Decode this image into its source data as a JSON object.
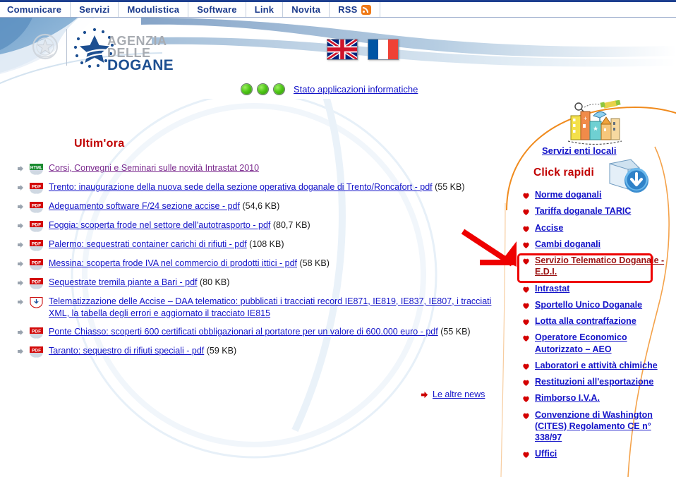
{
  "topnav": {
    "items": [
      {
        "label": "Comunicare",
        "icon": ""
      },
      {
        "label": "Servizi",
        "icon": ""
      },
      {
        "label": "Modulistica",
        "icon": ""
      },
      {
        "label": "Software",
        "icon": ""
      },
      {
        "label": "Link",
        "icon": ""
      },
      {
        "label": "Novita",
        "icon": ""
      },
      {
        "label": "RSS",
        "icon": "rss-icon"
      }
    ]
  },
  "header": {
    "emblem_icon": "italian-republic-emblem",
    "logo_star_icon": "agenzia-dogane-star-logo",
    "logo_line1": "AGENZIA",
    "logo_line2": "DELLE",
    "logo_line3": "DOGANE",
    "flags": [
      {
        "name": "flag-uk",
        "label": "English"
      },
      {
        "name": "flag-fr",
        "label": "Français"
      }
    ]
  },
  "status_line": {
    "dots": 3,
    "dot_color": "#4fc717",
    "link_label": "Stato applicazioni informatiche"
  },
  "content": {
    "heading": "Ultim'ora",
    "more_news_label": "Le altre news",
    "news": [
      {
        "type": "HTML",
        "title": "Corsi, Convegni e Seminari sulle novità Intrastat 2010",
        "size": "",
        "visited": true
      },
      {
        "type": "PDF",
        "title": "Trento: inaugurazione della nuova sede della sezione operativa doganale di Trento/Roncafort - pdf",
        "size": "(55 KB)",
        "visited": false
      },
      {
        "type": "PDF",
        "title": "Adeguamento software F/24 sezione accise - pdf",
        "size": "(54,6 KB)",
        "visited": false
      },
      {
        "type": "PDF",
        "title": "Foggia: scoperta frode nel settore dell'autotrasporto - pdf",
        "size": "(80,7 KB)",
        "visited": false
      },
      {
        "type": "PDF",
        "title": "Palermo: sequestrati container carichi di rifiuti - pdf",
        "size": "(108 KB)",
        "visited": false
      },
      {
        "type": "PDF",
        "title": "Messina: scoperta frode IVA nel commercio di prodotti ittici - pdf",
        "size": "(58 KB)",
        "visited": false
      },
      {
        "type": "PDF",
        "title": "Sequestrate tremila piante a Bari - pdf",
        "size": "(80 KB)",
        "visited": false
      },
      {
        "type": "DOWNLOAD",
        "title": "Telematizzazione delle Accise – DAA telematico: pubblicati i tracciati record IE871, IE819, IE837, IE807, i tracciati XML, la tabella degli errori e aggiornato il tracciato IE815",
        "size": "",
        "visited": false
      },
      {
        "type": "PDF",
        "title": "Ponte Chiasso: scoperti 600 certificati obbligazionari al portatore per un valore di 600.000 euro - pdf",
        "size": "(55 KB)",
        "visited": false
      },
      {
        "type": "PDF",
        "title": "Taranto: sequestro di rifiuti speciali - pdf",
        "size": "(59 KB)",
        "visited": false
      }
    ]
  },
  "sidebar": {
    "city_icon": "city-buildings-icon",
    "enti_locali_label": "Servizi enti locali",
    "click_rapidi_label": "Click rapidi",
    "download_icon": "download-arrow-icon",
    "links": [
      {
        "label": "Norme doganali",
        "highlight": false
      },
      {
        "label": "Tariffa doganale TARIC",
        "highlight": false
      },
      {
        "label": "Accise",
        "highlight": false
      },
      {
        "label": "Cambi doganali",
        "highlight": false
      },
      {
        "label": "Servizio Telematico Doganale - E.D.I.",
        "highlight": true
      },
      {
        "label": "Intrastat",
        "highlight": false
      },
      {
        "label": "Sportello Unico Doganale",
        "highlight": false
      },
      {
        "label": "Lotta alla contraffazione",
        "highlight": false
      },
      {
        "label": "Operatore Economico Autorizzato – AEO",
        "highlight": false
      },
      {
        "label": "Laboratori e attività chimiche",
        "highlight": false
      },
      {
        "label": "Restituzioni all'esportazione",
        "highlight": false
      },
      {
        "label": "Rimborso I.V.A.",
        "highlight": false
      },
      {
        "label": "Convenzione di Washington (CITES) Regolamento CE n° 338/97",
        "highlight": false
      },
      {
        "label": "Uffici",
        "highlight": false
      }
    ]
  },
  "annotation": {
    "arrow_icon": "red-arrow-pointer",
    "box_icon": "red-highlight-box",
    "color": "#ee0000",
    "target": "Servizio Telematico Doganale - E.D.I."
  },
  "colors": {
    "nav_text": "#1a3a8c",
    "link_blue": "#1313c8",
    "visited_purple": "#7b2a8e",
    "heading_red": "#c00000",
    "annotation_red": "#ee0000",
    "logo_blue": "#1d4f91",
    "bullet_red": "#d40000",
    "arc_orange": "#f08b1e"
  }
}
